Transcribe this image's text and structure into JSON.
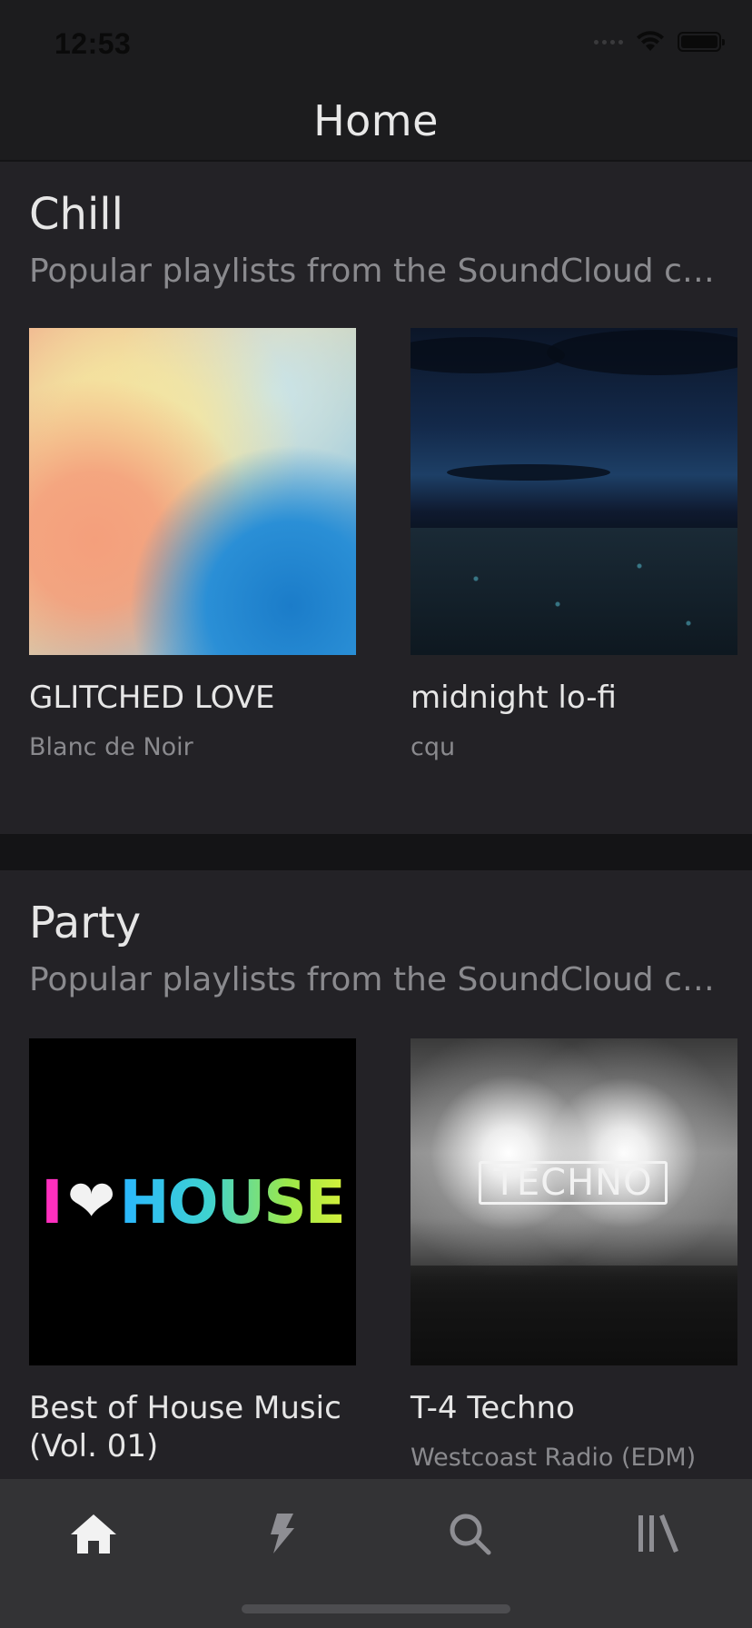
{
  "status_bar": {
    "time": "12:53"
  },
  "nav": {
    "title": "Home"
  },
  "sections": [
    {
      "title": "Chill",
      "subtitle": "Popular playlists from the SoundCloud community",
      "items": [
        {
          "title": "GLITCHED LOVE",
          "subtitle": "Blanc de Noir"
        },
        {
          "title": "midnight lo-fi",
          "subtitle": "cqu"
        }
      ]
    },
    {
      "title": "Party",
      "subtitle": "Popular playlists from the SoundCloud community",
      "items": [
        {
          "title": "Best of House Music (Vol. 01)",
          "subtitle": "",
          "art_text": {
            "i": "I",
            "heart": "❤",
            "word": "HOUSE"
          }
        },
        {
          "title": "T-4 Techno",
          "subtitle": "Westcoast Radio (EDM)",
          "art_text": "TECHNO"
        }
      ]
    }
  ],
  "tabs": [
    {
      "icon": "home-icon",
      "active": true
    },
    {
      "icon": "stream-icon",
      "active": false
    },
    {
      "icon": "search-icon",
      "active": false
    },
    {
      "icon": "library-icon",
      "active": false
    }
  ],
  "colors": {
    "background": "#232226",
    "nav_background": "#1c1c1e",
    "tab_bar": "#333335",
    "text_primary": "#e6e6e6",
    "text_secondary": "#8a8a8e"
  }
}
